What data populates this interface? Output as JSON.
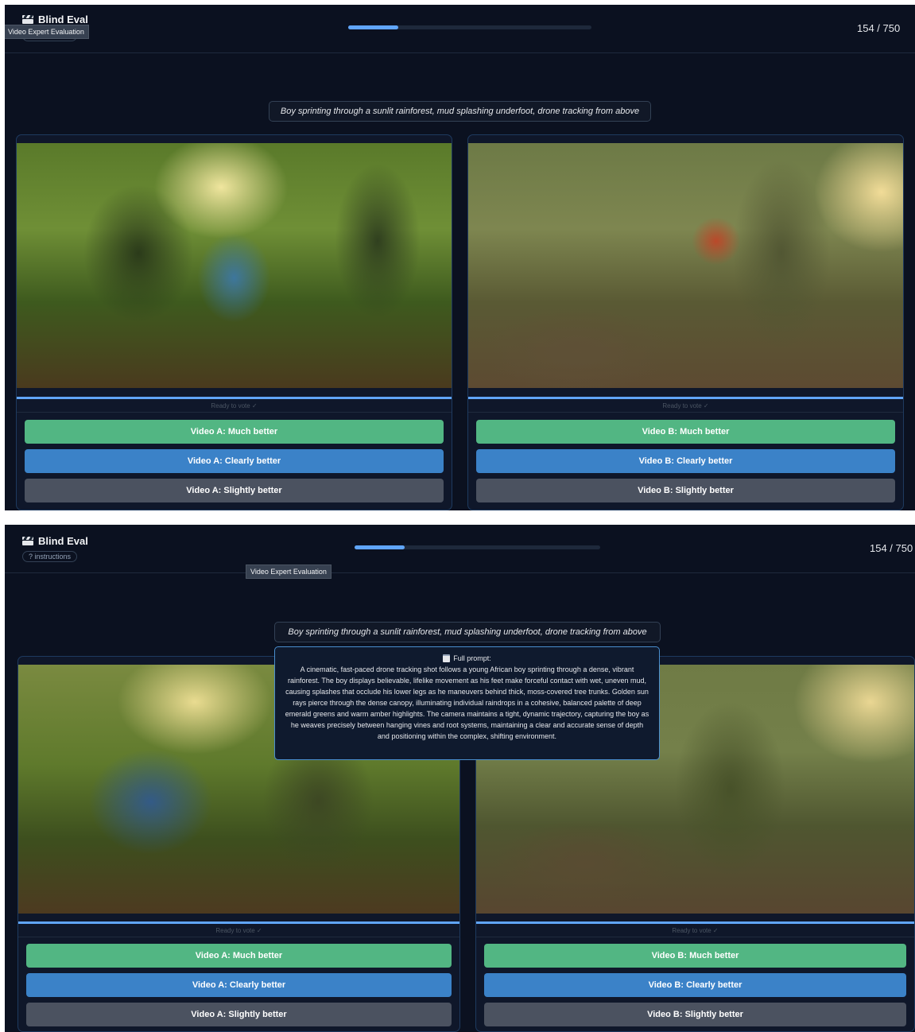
{
  "app": {
    "title": "Blind Eval",
    "instructions_label": "? instructions",
    "tooltip": "Video Expert Evaluation",
    "counter": "154 / 750",
    "progress": 0.205
  },
  "prompt": {
    "short": "Boy sprinting through a sunlit rainforest, mud splashing underfoot, drone tracking from above",
    "full_label": "Full prompt:",
    "full": "A cinematic, fast-paced drone tracking shot follows a young African boy sprinting through a dense, vibrant rainforest. The boy displays believable, lifelike movement as his feet make forceful contact with wet, uneven mud, causing splashes that occlude his lower legs as he maneuvers behind thick, moss-covered tree trunks. Golden sun rays pierce through the dense canopy, illuminating individual raindrops in a cohesive, balanced palette of deep emerald greens and warm amber highlights. The camera maintains a tight, dynamic trajectory, capturing the boy as he weaves precisely between hanging vines and root systems, maintaining a clear and accurate sense of depth and positioning within the complex, shifting environment."
  },
  "video_a": {
    "status": "Ready to vote ✓",
    "buttons": [
      "Video A: Much better",
      "Video A: Clearly better",
      "Video A: Slightly better"
    ]
  },
  "video_b": {
    "status": "Ready to vote ✓",
    "buttons": [
      "Video B: Much better",
      "Video B: Clearly better",
      "Video B: Slightly better"
    ]
  },
  "icons": {
    "brand": "clapperboard-icon",
    "full_prompt": "clipboard-icon"
  },
  "colors": {
    "background": "#0b1120",
    "progress": "#60a5fa",
    "much_better": "#52b683",
    "clearly_better": "#3b82c8",
    "slightly_better": "#4b5260"
  }
}
